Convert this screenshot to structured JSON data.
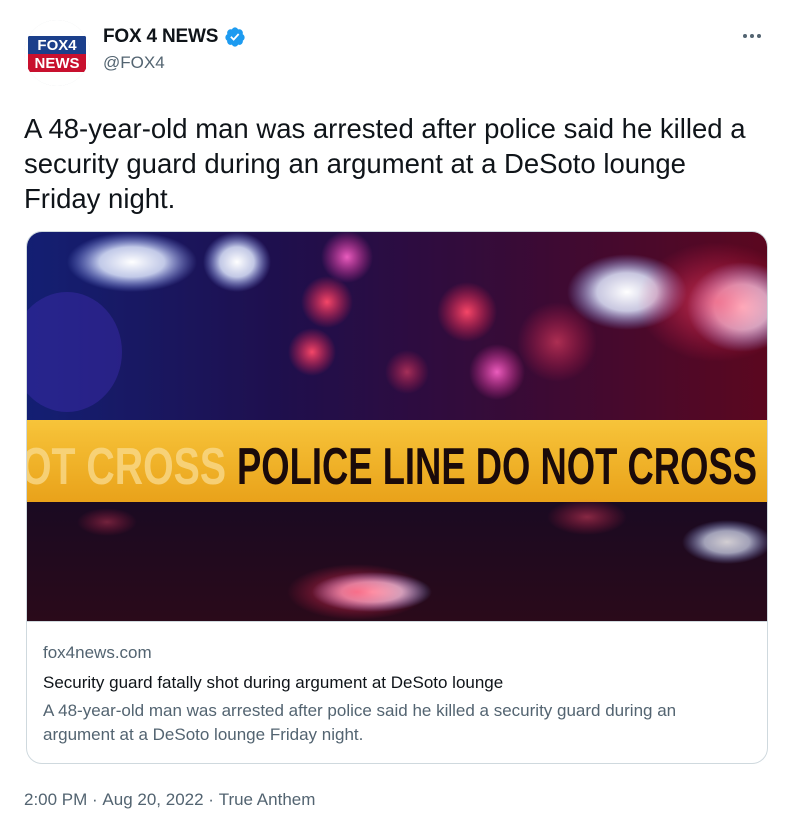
{
  "account": {
    "display_name": "FOX 4 NEWS",
    "handle": "@FOX4",
    "avatar_text_top": "FOX4",
    "avatar_text_bottom": "NEWS",
    "verified_icon": "verified-badge-icon",
    "verified_color": "#1d9bf0"
  },
  "tweet": {
    "text": "A 48-year-old man was arrested after police said he killed a security guard during an argument at a DeSoto lounge Friday night."
  },
  "card": {
    "image_tape_text": "POLICE LINE DO NOT CROSS",
    "image_tape_faded_text": "OT CROSS",
    "domain": "fox4news.com",
    "title": "Security guard fatally shot during argument at DeSoto lounge",
    "description": "A 48-year-old man was arrested after police said he killed a security guard during an argument at a DeSoto lounge Friday night."
  },
  "meta": {
    "time": "2:00 PM",
    "separator": " · ",
    "date": "Aug 20, 2022",
    "separator2": " · ",
    "source": "True Anthem"
  },
  "icons": {
    "more": "more-options-icon"
  },
  "colors": {
    "text_primary": "#0f1419",
    "text_secondary": "#536471",
    "border": "#cfd9de",
    "tape_yellow": "#f2b21c",
    "fox_red": "#c8102e"
  }
}
